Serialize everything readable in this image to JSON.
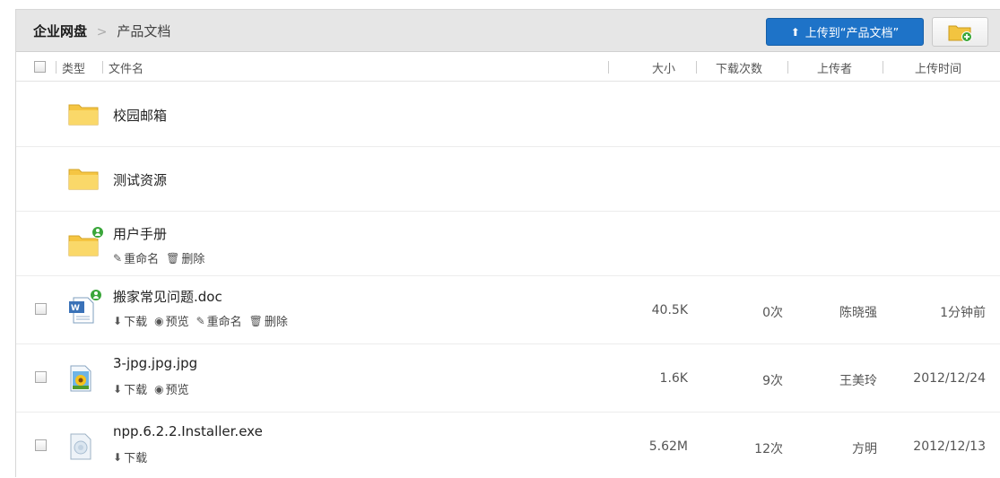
{
  "breadcrumb": {
    "root": "企业网盘",
    "separator": ">",
    "current": "产品文档"
  },
  "toolbar": {
    "upload_label": "上传到“产品文档”",
    "newfolder_icon": "new-folder-icon"
  },
  "columns": {
    "type": "类型",
    "name": "文件名",
    "size": "大小",
    "downloads": "下载次数",
    "uploader": "上传者",
    "time": "上传时间"
  },
  "rows": [
    {
      "kind": "folder",
      "name": "校园邮箱"
    },
    {
      "kind": "folder",
      "name": "测试资源"
    },
    {
      "kind": "folder",
      "name": "用户手册",
      "shared": true,
      "actions": {
        "rename": "重命名",
        "delete": "删除"
      }
    },
    {
      "kind": "doc",
      "name": "搬家常见问题.doc",
      "shared": true,
      "actions": {
        "download": "下载",
        "preview": "预览",
        "rename": "重命名",
        "delete": "删除"
      },
      "size": "40.5K",
      "downloads": "0次",
      "uploader": "陈晓强",
      "time": "1分钟前"
    },
    {
      "kind": "image",
      "name": "3-jpg.jpg.jpg",
      "actions": {
        "download": "下载",
        "preview": "预览"
      },
      "size": "1.6K",
      "downloads": "9次",
      "uploader": "王美玲",
      "time": "2012/12/24"
    },
    {
      "kind": "exe",
      "name": "npp.6.2.2.Installer.exe",
      "actions": {
        "download": "下载"
      },
      "size": "5.62M",
      "downloads": "12次",
      "uploader": "方明",
      "time": "2012/12/13"
    }
  ],
  "colors": {
    "topbar": "#e6e6e6",
    "accent": "#1e73c8",
    "folder": "#f5c542",
    "shared_badge": "#3aa63a"
  }
}
